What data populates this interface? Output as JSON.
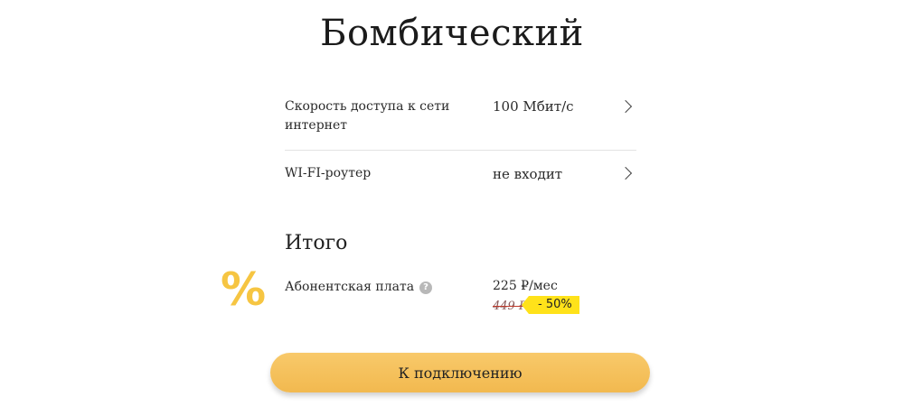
{
  "tariff": {
    "title": "Бомбический"
  },
  "options": [
    {
      "label": "Скорость доступа к сети интернет",
      "value": "100 Мбит/с"
    },
    {
      "label": "WI-FI-роутер",
      "value": "не входит"
    }
  ],
  "summary": {
    "title": "Итого",
    "percent_symbol": "%",
    "fee_label": "Абонентская плата",
    "help_symbol": "?",
    "price_new": "225 ₽/мес",
    "price_old": "449 ₽",
    "discount": "- 50%"
  },
  "actions": {
    "connect_label": "К подключению"
  },
  "colors": {
    "accent": "#f6c542",
    "button": "#f5c15c",
    "discount_badge": "#ffe21a"
  }
}
